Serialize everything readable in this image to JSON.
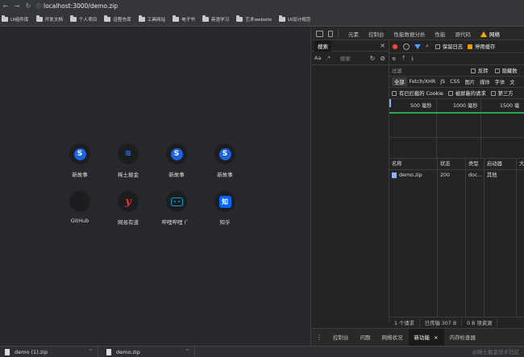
{
  "browser": {
    "nav": {
      "back": "←",
      "forward": "→",
      "reload": "C"
    },
    "url": "localhost:3000/demo.zip",
    "bookmarks": [
      "UI组件库",
      "开发文档",
      "个人项目",
      "远程仓库",
      "工具网站",
      "电子书",
      "英语学习",
      "艺术website",
      "UI设计规范"
    ]
  },
  "newtab": {
    "tiles": [
      {
        "label": "新故事",
        "icon": "S"
      },
      {
        "label": "稀土掘金",
        "icon": "≋"
      },
      {
        "label": "新故事",
        "icon": "S"
      },
      {
        "label": "新故事",
        "icon": "S"
      },
      {
        "label": "GitHub",
        "icon": ""
      },
      {
        "label": "网易有道",
        "icon": "y"
      },
      {
        "label": "哔哩哔哩 (゜",
        "icon": ""
      },
      {
        "label": "知乎",
        "icon": "知"
      }
    ]
  },
  "devtools": {
    "tabs": [
      "元素",
      "控制台",
      "性能数据分析",
      "性能",
      "源代码",
      "网络"
    ],
    "search": {
      "tab": "搜索",
      "aa": "Aa",
      "regex": ".*",
      "placeholder": "搜索"
    },
    "network": {
      "preserve_log": "保留日志",
      "disable_cache": "停用缓存",
      "filter_placeholder": "过滤",
      "invert": "反转",
      "hide_data": "隐藏数",
      "types": [
        "全部",
        "Fetch/XHR",
        "JS",
        "CSS",
        "图片",
        "媒体",
        "字体",
        "文"
      ],
      "blocked_cookies": "有已拦截的 Cookie",
      "blocked_requests": "被屏蔽的请求",
      "third_party": "第三方",
      "timeline_labels": [
        "500 毫秒",
        "1000 毫秒",
        "1500 毫"
      ],
      "columns": [
        "名称",
        "状态",
        "类型",
        "启动器",
        "大"
      ],
      "rows": [
        {
          "name": "demo.zip",
          "status": "200",
          "type": "doc...",
          "initiator": "其他",
          "size": ""
        }
      ],
      "status_bar": [
        "1 个请求",
        "已传输 307 B",
        "0 B 项资源"
      ]
    },
    "drawer_tabs": [
      "控制台",
      "问题",
      "网络状况",
      "新功能",
      "内存检查器"
    ],
    "drawer_active_close": "×"
  },
  "downloads": [
    {
      "name": "demo (1).zip"
    },
    {
      "name": "demo.zip"
    }
  ],
  "watermark": "@稀土掘金技术社区"
}
